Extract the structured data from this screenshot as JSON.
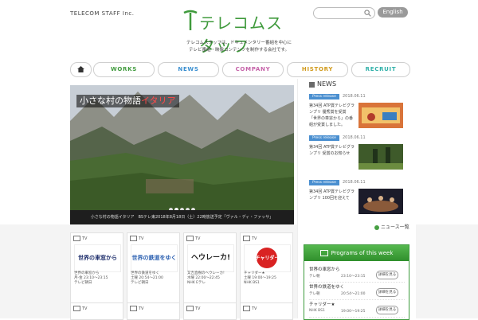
{
  "header": {
    "company": "TELECOM STAFF Inc.",
    "logo_text": "テレコムスタッフ",
    "search": {
      "placeholder": ""
    },
    "language_button": "English",
    "tagline": [
      "テレコムスタッフは、ドキュメンタリー番組を中心に",
      "テレビ番組・映像コンテンツを制作する会社です。"
    ]
  },
  "nav": {
    "items": [
      {
        "label": "WORKS",
        "color": "#3f9a3c"
      },
      {
        "label": "NEWS",
        "color": "#3a8fd0"
      },
      {
        "label": "COMPANY",
        "color": "#c561a8"
      },
      {
        "label": "HISTORY",
        "color": "#d19a1b"
      },
      {
        "label": "RECRUIT",
        "color": "#2fb0a8"
      }
    ]
  },
  "hero": {
    "title_white": "小さな村の物語",
    "title_red": "イタリア",
    "caption": "小さな村の物語イタリア　BSテレ東2018年8月18日（土）22時放送予定「ヴァル・ディ・ファッサ」"
  },
  "news": {
    "heading": "NEWS",
    "items": [
      {
        "badge": "Press release",
        "date": "2018.06.11",
        "text": "第34回 ATP賞テレビグランプリ 優秀賞を受賞 「世界の車窓から」の番組が受賞しました。"
      },
      {
        "badge": "Press release",
        "date": "2018.06.11",
        "text": "第34回 ATP賞テレビグランプリ 受賞のお知らせ"
      },
      {
        "badge": "Press release",
        "date": "2018.06.11",
        "text": "第34回 ATP賞テレビグランプリ 100回を迎えて"
      }
    ],
    "more": "ニュース一覧"
  },
  "cards": [
    {
      "type": "TV",
      "logo": "世界の車窓から",
      "title": "世界の車窓から",
      "time": "月-金 23:10～23:15",
      "channel": "テレビ朝日"
    },
    {
      "type": "TV",
      "logo": "世界の鉄道をゆく",
      "title": "世界の鉄道をゆく",
      "time": "土曜 20:54～21:00",
      "channel": "テレビ朝日"
    },
    {
      "type": "TV",
      "logo": "ヘウレーカ!",
      "title": "又吉直樹のヘウレーカ!",
      "time": "水曜 22:00～22:45",
      "channel": "NHK Eテレ"
    },
    {
      "type": "TV",
      "logo": "チャリダー",
      "title": "チャリダー★",
      "time": "土曜 19:00～19:25",
      "channel": "NHK BS1"
    }
  ],
  "cards_row2": [
    {
      "type": "TV"
    },
    {
      "type": "TV"
    },
    {
      "type": "TV"
    },
    {
      "type": "TV"
    }
  ],
  "programs": {
    "heading": "Programs of this week",
    "rows": [
      {
        "title": "世界の車窓から",
        "channel": "テレ朝",
        "time": "23:10～23:15",
        "button": "詳細を見る"
      },
      {
        "title": "世界の鉄道をゆく",
        "channel": "テレ朝",
        "time": "20:54～21:00",
        "button": "詳細を見る"
      },
      {
        "title": "チャリダー★",
        "channel": "NHK BS1",
        "time": "19:00～19:25",
        "button": "詳細を見る"
      }
    ]
  }
}
